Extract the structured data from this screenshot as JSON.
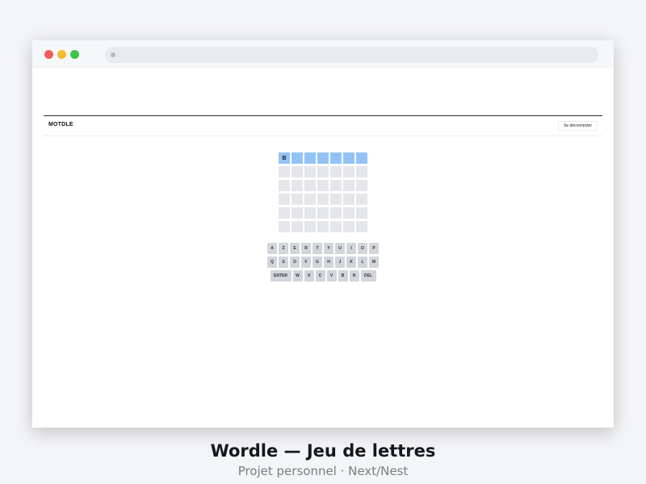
{
  "header": {
    "brand": "MOTDLE",
    "login_label": "Se déconnecter"
  },
  "board": {
    "rows": [
      [
        "B",
        "",
        "",
        "",
        "",
        "",
        ""
      ],
      [
        "",
        "",
        "",
        "",
        "",
        "",
        ""
      ],
      [
        "",
        "",
        "",
        "",
        "",
        "",
        ""
      ],
      [
        "",
        "",
        "",
        "",
        "",
        "",
        ""
      ],
      [
        "",
        "",
        "",
        "",
        "",
        "",
        ""
      ],
      [
        "",
        "",
        "",
        "",
        "",
        "",
        ""
      ]
    ],
    "active_row": 0
  },
  "keyboard": {
    "rows": [
      [
        "A",
        "Z",
        "E",
        "R",
        "T",
        "Y",
        "U",
        "I",
        "O",
        "P"
      ],
      [
        "Q",
        "S",
        "D",
        "F",
        "G",
        "H",
        "J",
        "K",
        "L",
        "M"
      ],
      [
        "ENTER",
        "W",
        "X",
        "C",
        "V",
        "B",
        "N",
        "DEL"
      ]
    ]
  },
  "caption": {
    "title": "Wordle — Jeu de lettres",
    "subtitle": "Projet personnel · Next/Nest"
  },
  "colors": {
    "active_cell": "#93c3f5",
    "empty_cell": "#e4e6ea",
    "key": "#d2d5db"
  }
}
